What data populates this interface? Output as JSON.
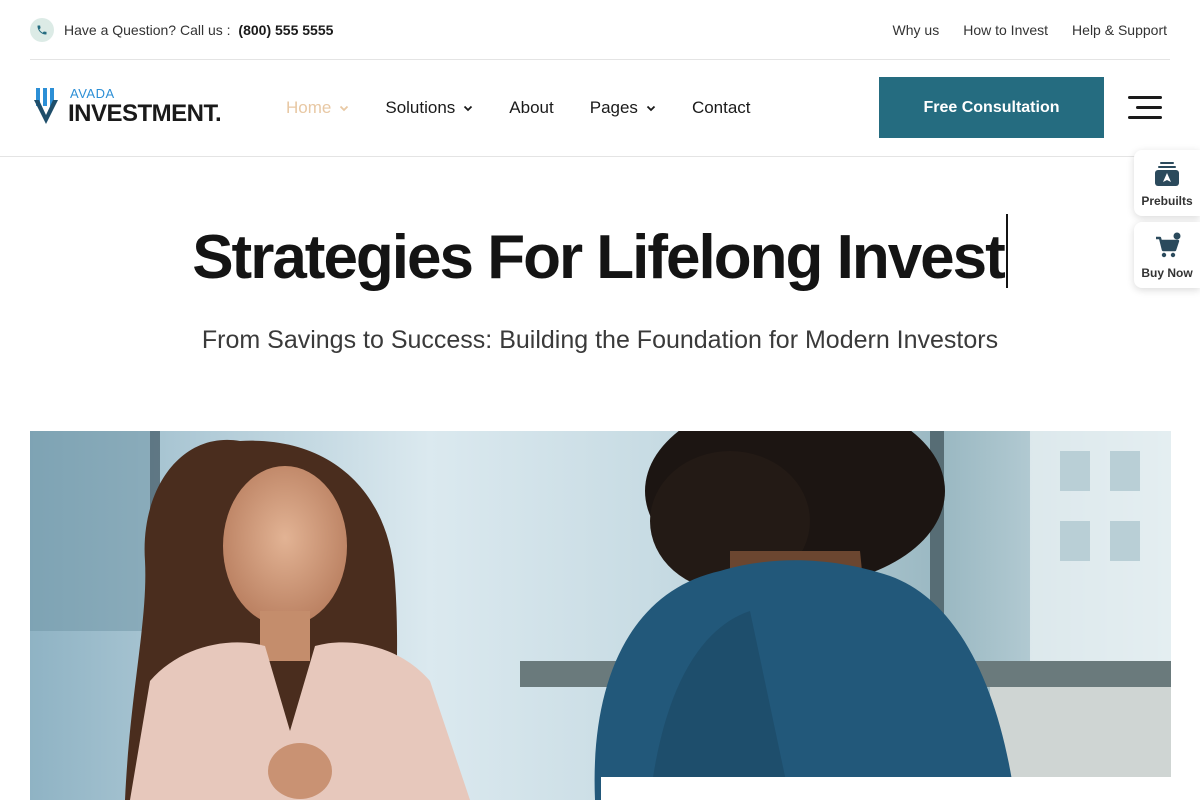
{
  "topbar": {
    "question_text": "Have a Question? Call us :",
    "phone_number": "(800) 555 5555",
    "links": [
      "Why us",
      "How to Invest",
      "Help & Support"
    ]
  },
  "logo": {
    "small_text": "AVADA",
    "big_text": "INVESTMENT."
  },
  "nav": {
    "items": [
      {
        "label": "Home",
        "dropdown": true,
        "active": true
      },
      {
        "label": "Solutions",
        "dropdown": true,
        "active": false
      },
      {
        "label": "About",
        "dropdown": false,
        "active": false
      },
      {
        "label": "Pages",
        "dropdown": true,
        "active": false
      },
      {
        "label": "Contact",
        "dropdown": false,
        "active": false
      }
    ],
    "cta_label": "Free Consultation"
  },
  "side_widgets": {
    "prebuilts_label": "Prebuilts",
    "buy_now_label": "Buy Now"
  },
  "hero": {
    "title": "Strategies For Lifelong Invest",
    "subtitle": "From Savings to Success: Building the Foundation for Modern Investors"
  },
  "colors": {
    "accent": "#256c80",
    "active_nav": "#e8c8a4",
    "logo_blue": "#2c8fd6"
  },
  "icons": {
    "phone": "phone-icon",
    "chevron": "chevron-down-icon",
    "menu": "hamburger-menu-icon",
    "prebuilts": "stack-icon",
    "buy_now": "cart-icon"
  }
}
